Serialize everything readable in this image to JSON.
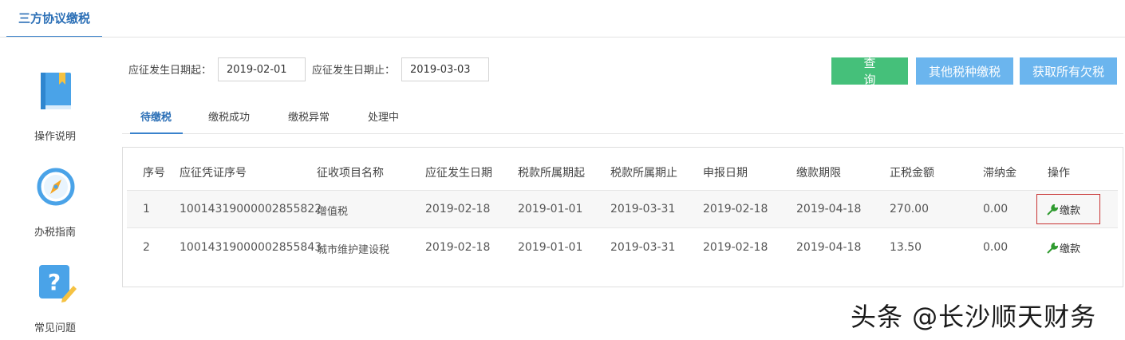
{
  "header": {
    "tab_title": "三方协议缴税"
  },
  "sidebar": {
    "items": [
      {
        "label": "操作说明",
        "icon": "book-icon"
      },
      {
        "label": "办税指南",
        "icon": "compass-icon"
      },
      {
        "label": "常见问题",
        "icon": "question-icon"
      }
    ]
  },
  "filters": {
    "start_label": "应征发生日期起：",
    "start_value": "2019-02-01",
    "end_label": "应征发生日期止：",
    "end_value": "2019-03-03"
  },
  "buttons": {
    "query": "查询",
    "other_tax": "其他税种缴税",
    "fetch_all": "获取所有欠税"
  },
  "tabs": [
    {
      "label": "待缴税",
      "active": true
    },
    {
      "label": "缴税成功",
      "active": false
    },
    {
      "label": "缴税异常",
      "active": false
    },
    {
      "label": "处理中",
      "active": false
    }
  ],
  "table": {
    "columns": [
      "序号",
      "应征凭证序号",
      "征收项目名称",
      "应征发生日期",
      "税款所属期起",
      "税款所属期止",
      "申报日期",
      "缴款期限",
      "正税金额",
      "滞纳金",
      "操作"
    ],
    "rows": [
      {
        "no": "1",
        "voucher": "10014319000002855822",
        "item": "增值税",
        "occur": "2019-02-18",
        "period_start": "2019-01-01",
        "period_end": "2019-03-31",
        "declare": "2019-02-18",
        "deadline": "2019-04-18",
        "amount": "270.00",
        "late_fee": "0.00",
        "action": "缴款"
      },
      {
        "no": "2",
        "voucher": "10014319000002855843",
        "item": "城市维护建设税",
        "occur": "2019-02-18",
        "period_start": "2019-01-01",
        "period_end": "2019-03-31",
        "declare": "2019-02-18",
        "deadline": "2019-04-18",
        "amount": "13.50",
        "late_fee": "0.00",
        "action": "缴款"
      }
    ]
  },
  "colors": {
    "accent": "#3a82cc",
    "query_button": "#45c07a",
    "action_button": "#6bb5ee",
    "highlight_border": "#c83232",
    "pay_icon": "#2e9a2e"
  },
  "watermark": "头条 @长沙顺天财务"
}
